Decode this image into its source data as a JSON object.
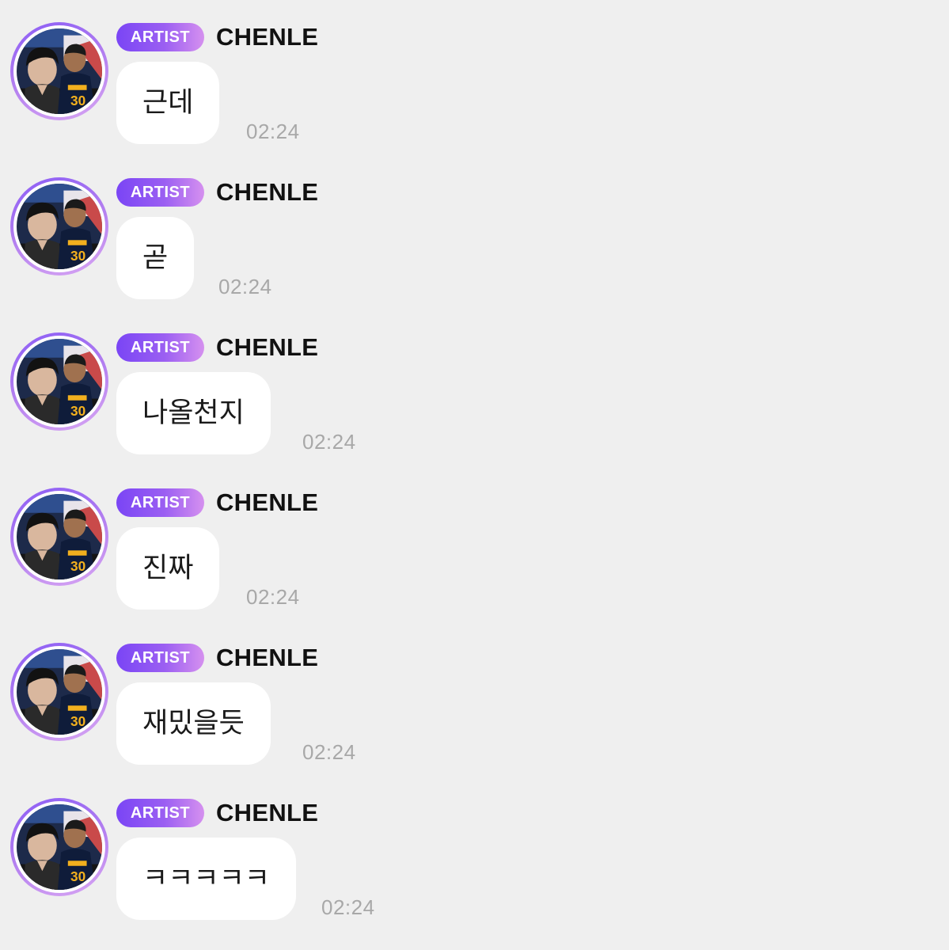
{
  "messages": [
    {
      "badge": "ARTIST",
      "sender": "CHENLE",
      "text": "근데",
      "time": "02:24"
    },
    {
      "badge": "ARTIST",
      "sender": "CHENLE",
      "text": "곧",
      "time": "02:24"
    },
    {
      "badge": "ARTIST",
      "sender": "CHENLE",
      "text": "나올천지",
      "time": "02:24"
    },
    {
      "badge": "ARTIST",
      "sender": "CHENLE",
      "text": "진짜",
      "time": "02:24"
    },
    {
      "badge": "ARTIST",
      "sender": "CHENLE",
      "text": "재밌을듯",
      "time": "02:24"
    },
    {
      "badge": "ARTIST",
      "sender": "CHENLE",
      "text": "ㅋㅋㅋㅋㅋ",
      "time": "02:24"
    }
  ],
  "colors": {
    "background": "#efefef",
    "bubble": "#ffffff",
    "badge_start": "#7a45f5",
    "badge_end": "#d590ef",
    "timestamp": "#a8a8a8",
    "sender_name": "#111111"
  },
  "icons": {
    "avatar": "profile-photo-avatar"
  }
}
